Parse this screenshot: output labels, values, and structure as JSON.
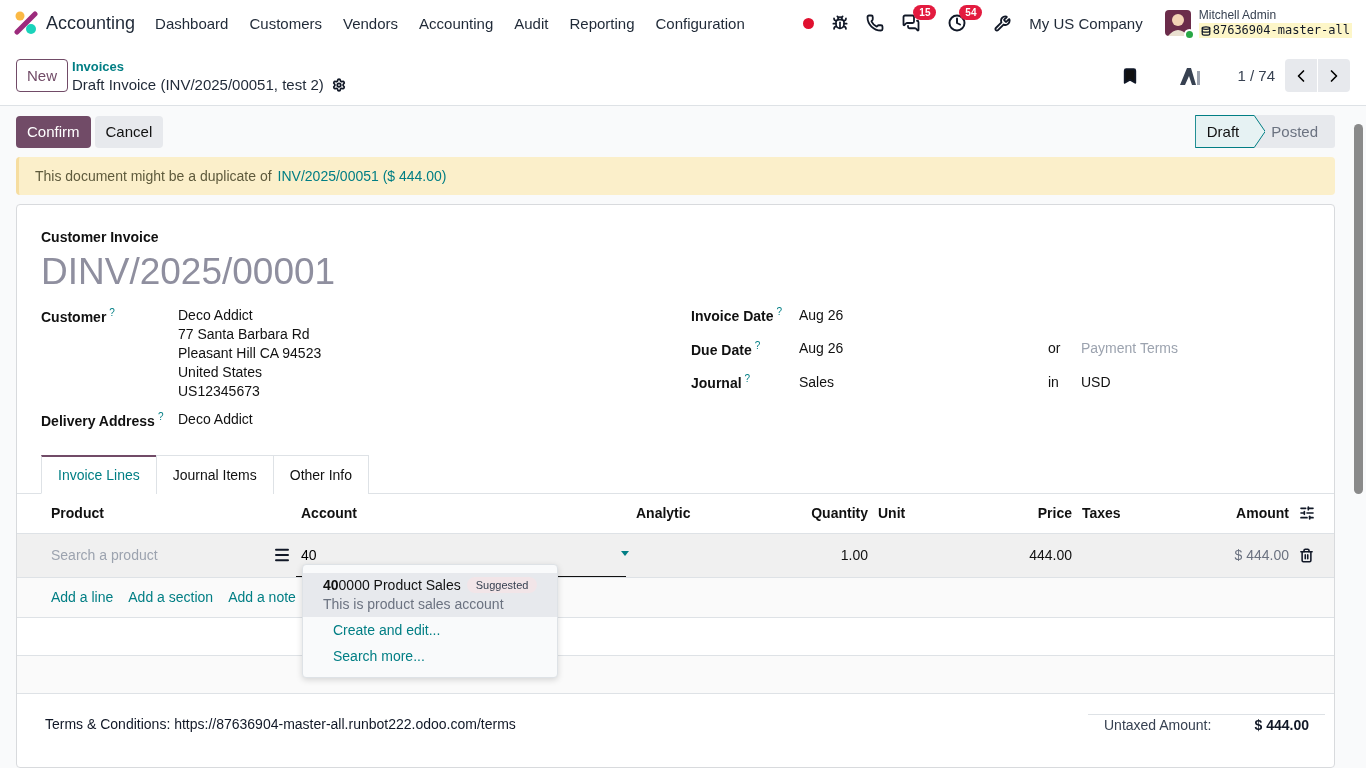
{
  "app": {
    "name": "Accounting"
  },
  "menu": [
    {
      "label": "Dashboard"
    },
    {
      "label": "Customers"
    },
    {
      "label": "Vendors"
    },
    {
      "label": "Accounting"
    },
    {
      "label": "Audit"
    },
    {
      "label": "Reporting"
    },
    {
      "label": "Configuration"
    }
  ],
  "systray": {
    "messages_badge": "15",
    "activities_badge": "54",
    "company": "My US Company",
    "user": "Mitchell Admin",
    "database": "87636904-master-all"
  },
  "new_button": "New",
  "breadcrumb": {
    "parent": "Invoices",
    "current": "Draft Invoice (INV/2025/00051, test 2)"
  },
  "pager": {
    "value": "1 / 74"
  },
  "actions": [
    {
      "label": "Confirm",
      "kind": "primary"
    },
    {
      "label": "Cancel",
      "kind": "secondary"
    }
  ],
  "status_steps": [
    {
      "label": "Draft",
      "selected": true
    },
    {
      "label": "Posted",
      "selected": false
    }
  ],
  "alert": {
    "text": "This document might be a duplicate of",
    "link": "INV/2025/00051 ($ 444.00)"
  },
  "form": {
    "type_label": "Customer Invoice",
    "number": "DINV/2025/00001",
    "left_fields": [
      {
        "label": "Customer",
        "help": "?",
        "lines": [
          "Deco Addict",
          "77 Santa Barbara Rd",
          "Pleasant Hill CA 94523",
          "United States",
          "US12345673"
        ]
      },
      {
        "label": "Delivery Address",
        "help": "?",
        "lines": [
          "Deco Addict"
        ]
      }
    ],
    "right_fields": [
      {
        "label": "Invoice Date",
        "help": "?",
        "value": "Aug 26"
      },
      {
        "label": "Due Date",
        "help": "?",
        "value": "Aug 26",
        "joiner": "or",
        "extra": {
          "placeholder": "Payment Terms"
        }
      },
      {
        "label": "Journal",
        "help": "?",
        "value": "Sales",
        "joiner": "in",
        "extra": {
          "value": "USD"
        }
      }
    ]
  },
  "tabs": [
    {
      "label": "Invoice Lines",
      "selected": true
    },
    {
      "label": "Journal Items",
      "selected": false
    },
    {
      "label": "Other Info",
      "selected": false
    }
  ],
  "table": {
    "columns": [
      "Product",
      "Account",
      "Analytic",
      "Quantity",
      "Unit",
      "Price",
      "Taxes",
      "Amount"
    ],
    "row": {
      "product_placeholder": "Search a product",
      "account": "40",
      "quantity": "1.00",
      "price": "444.00",
      "amount": "$ 444.00"
    },
    "add_links": [
      "Add a line",
      "Add a section",
      "Add a note"
    ]
  },
  "account_dropdown": {
    "options": [
      {
        "name": "**40**0000 Product Sales",
        "badge": "Suggested",
        "description": "This is product sales account",
        "selected": true
      }
    ],
    "actions": [
      "Create and edit...",
      "Search more..."
    ]
  },
  "terms": "Terms & Conditions: https://87636904-master-all.runbot222.odoo.com/terms",
  "totals": [
    {
      "label": "Untaxed Amount:",
      "value": "$ 444.00"
    }
  ]
}
